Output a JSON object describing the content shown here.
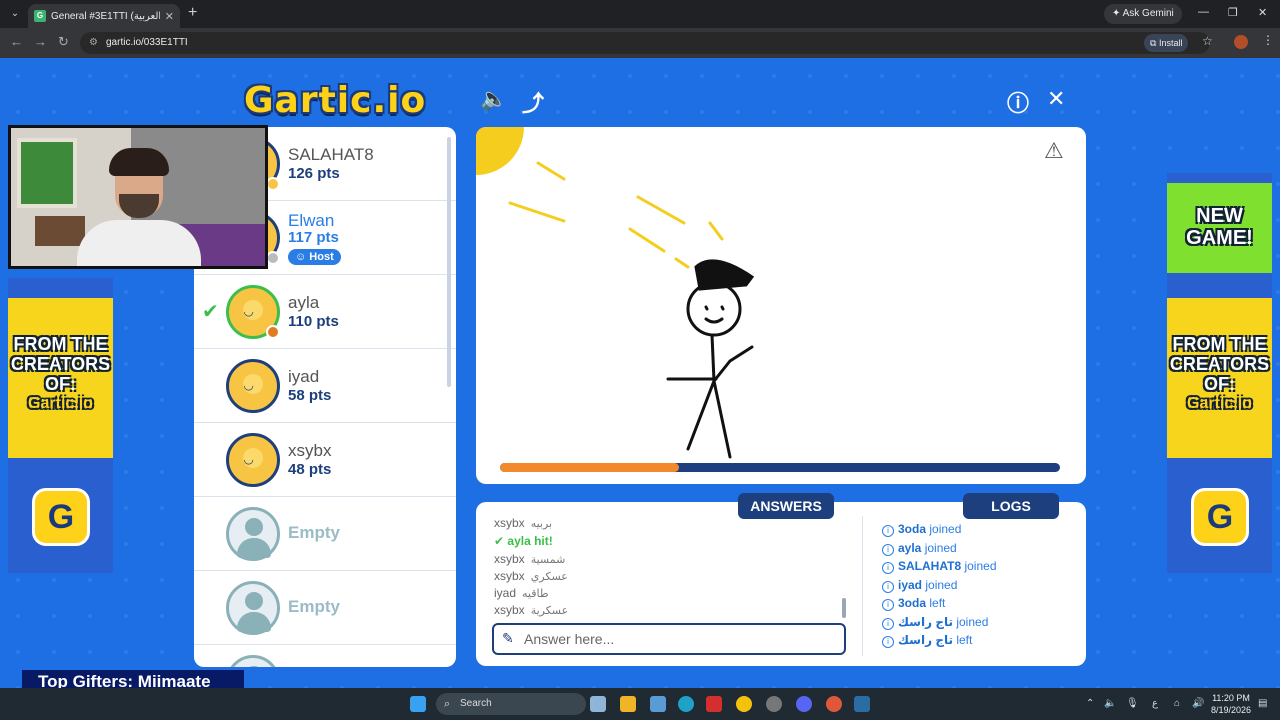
{
  "browser": {
    "tab_title": "General #3E1TTI (العربية) - Gartic",
    "url": "gartic.io/033E1TTI",
    "ask_gemini": "Ask Gemini",
    "install": "Install"
  },
  "game": {
    "logo": "Gartic.io",
    "players": [
      {
        "name": "SALAHAT8",
        "points": "126 pts",
        "host": false,
        "guessed": false,
        "status_dot": "#f7c543"
      },
      {
        "name": "Elwan",
        "points": "117 pts",
        "host": true,
        "host_label": "Host",
        "guessed": false,
        "status_dot": "#bbbbbb"
      },
      {
        "name": "ayla",
        "points": "110 pts",
        "host": false,
        "guessed": true,
        "status_dot": "#e07b1f"
      },
      {
        "name": "iyad",
        "points": "58 pts",
        "host": false,
        "guessed": false
      },
      {
        "name": "xsybx",
        "points": "48 pts",
        "host": false,
        "guessed": false
      },
      {
        "name": "Empty"
      },
      {
        "name": "Empty"
      }
    ],
    "timer_progress": 0.32,
    "tabs": {
      "answers": "ANSWERS",
      "logs": "LOGS"
    },
    "answers": [
      {
        "user": "xsybx",
        "word": "بربيه"
      },
      {
        "user": "ayla",
        "word": "hit!",
        "hit": true
      },
      {
        "user": "xsybx",
        "word": "شمسية"
      },
      {
        "user": "xsybx",
        "word": "عسكري"
      },
      {
        "user": "iyad",
        "word": "طاقيه"
      },
      {
        "user": "xsybx",
        "word": "عسكرية"
      }
    ],
    "answer_placeholder": "Answer here...",
    "logs": [
      {
        "user": "3oda",
        "action": "joined"
      },
      {
        "user": "ayla",
        "action": "joined"
      },
      {
        "user": "SALAHAT8",
        "action": "joined"
      },
      {
        "user": "iyad",
        "action": "joined"
      },
      {
        "user": "3oda",
        "action": "left"
      },
      {
        "user": "تاج راسك",
        "action": "joined"
      },
      {
        "user": "تاج راسك",
        "action": "left"
      }
    ],
    "ads": {
      "from_creators": "FROM THE CREATORS OF:",
      "new_game": "NEW GAME!",
      "mini_logo": "Gartic.io",
      "g": "G"
    }
  },
  "stream": {
    "top_gifters": "Top Gifters: Miimaate"
  },
  "taskbar": {
    "search": "Search",
    "time": "11:20 PM",
    "date": "8/19/2026",
    "lang": "ع"
  }
}
